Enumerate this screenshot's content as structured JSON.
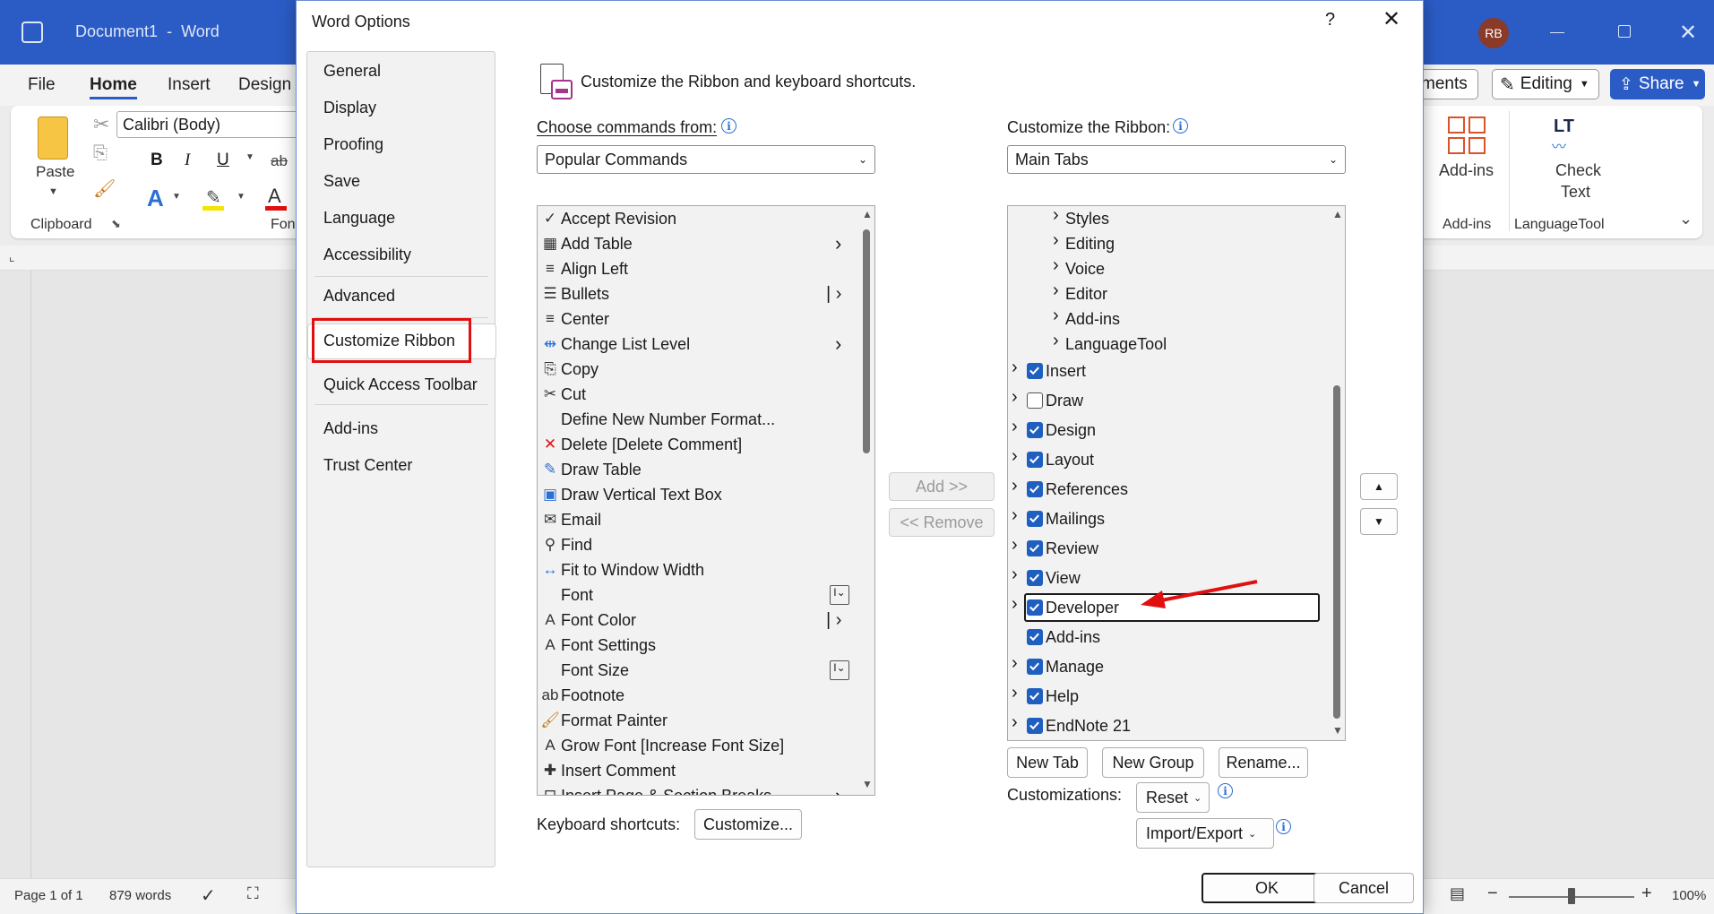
{
  "word": {
    "doc_title": "Document1",
    "separator": "-",
    "app_name": "Word",
    "user_initials": "RB",
    "menu": [
      "File",
      "Home",
      "Insert",
      "Design"
    ],
    "right_buttons": {
      "comments": "ments",
      "editing": "Editing",
      "share": "Share"
    },
    "ribbon": {
      "paste": "Paste",
      "clipboard": "Clipboard",
      "font_name": "Calibri (Body)",
      "font_group": "Font",
      "bold": "B",
      "italic": "I",
      "underline": "U",
      "strike": "ab",
      "addins": "Add-ins",
      "addins_group": "Add-ins",
      "check_text_1": "Check",
      "check_text_2": "Text",
      "languagetool_group": "LanguageTool",
      "lt_logo": "LT"
    },
    "status": {
      "page": "Page 1 of 1",
      "words": "879 words",
      "zoom": "100%"
    }
  },
  "dialog": {
    "title": "Word Options",
    "help": "?",
    "nav": [
      "General",
      "Display",
      "Proofing",
      "Save",
      "Language",
      "Accessibility",
      "Advanced",
      "Customize Ribbon",
      "Quick Access Toolbar",
      "Add-ins",
      "Trust Center"
    ],
    "selected_nav": "Customize Ribbon",
    "heading": "Customize the Ribbon and keyboard shortcuts.",
    "choose_label": "Choose commands from:",
    "choose_value": "Popular Commands",
    "customize_label": "Customize the Ribbon:",
    "customize_value": "Main Tabs",
    "commands": [
      {
        "label": "Accept Revision",
        "icon": "accept-revision-icon"
      },
      {
        "label": "Add Table",
        "icon": "table-icon",
        "suffix": "arrow"
      },
      {
        "label": "Align Left",
        "icon": "align-left-icon"
      },
      {
        "label": "Bullets",
        "icon": "bullets-icon",
        "suffix": "split-arrow"
      },
      {
        "label": "Center",
        "icon": "align-center-icon"
      },
      {
        "label": "Change List Level",
        "icon": "list-level-icon",
        "suffix": "arrow"
      },
      {
        "label": "Copy",
        "icon": "copy-icon"
      },
      {
        "label": "Cut",
        "icon": "scissors-icon"
      },
      {
        "label": "Define New Number Format...",
        "icon": ""
      },
      {
        "label": "Delete [Delete Comment]",
        "icon": "delete-comment-icon"
      },
      {
        "label": "Draw Table",
        "icon": "draw-table-icon"
      },
      {
        "label": "Draw Vertical Text Box",
        "icon": "text-box-icon"
      },
      {
        "label": "Email",
        "icon": "email-icon"
      },
      {
        "label": "Find",
        "icon": "find-icon"
      },
      {
        "label": "Fit to Window Width",
        "icon": "fit-width-icon"
      },
      {
        "label": "Font",
        "icon": "",
        "suffix": "combo"
      },
      {
        "label": "Font Color",
        "icon": "font-color-icon",
        "suffix": "split-arrow"
      },
      {
        "label": "Font Settings",
        "icon": "font-settings-icon"
      },
      {
        "label": "Font Size",
        "icon": "",
        "suffix": "combo"
      },
      {
        "label": "Footnote",
        "icon": "footnote-icon"
      },
      {
        "label": "Format Painter",
        "icon": "format-painter-icon"
      },
      {
        "label": "Grow Font [Increase Font Size]",
        "icon": "grow-font-icon"
      },
      {
        "label": "Insert Comment",
        "icon": "insert-comment-icon"
      },
      {
        "label": "Insert Page & Section Breaks",
        "icon": "page-break-icon",
        "suffix": "arrow"
      }
    ],
    "tabs": [
      {
        "label": "Styles",
        "level": 1
      },
      {
        "label": "Editing",
        "level": 1
      },
      {
        "label": "Voice",
        "level": 1
      },
      {
        "label": "Editor",
        "level": 1
      },
      {
        "label": "Add-ins",
        "level": 1
      },
      {
        "label": "LanguageTool",
        "level": 1
      },
      {
        "label": "Insert",
        "level": 0,
        "checked": true
      },
      {
        "label": "Draw",
        "level": 0,
        "checked": false
      },
      {
        "label": "Design",
        "level": 0,
        "checked": true
      },
      {
        "label": "Layout",
        "level": 0,
        "checked": true
      },
      {
        "label": "References",
        "level": 0,
        "checked": true
      },
      {
        "label": "Mailings",
        "level": 0,
        "checked": true
      },
      {
        "label": "Review",
        "level": 0,
        "checked": true
      },
      {
        "label": "View",
        "level": 0,
        "checked": true
      },
      {
        "label": "Developer",
        "level": 0,
        "checked": true,
        "selected": true
      },
      {
        "label": "Add-ins",
        "level": 0,
        "checked": true,
        "noexpand": true
      },
      {
        "label": "Manage",
        "level": 0,
        "checked": true
      },
      {
        "label": "Help",
        "level": 0,
        "checked": true
      },
      {
        "label": "EndNote 21",
        "level": 0,
        "checked": true
      }
    ],
    "add_button": "Add >>",
    "remove_button": "<< Remove",
    "new_tab": "New Tab",
    "new_group": "New Group",
    "rename": "Rename...",
    "customizations_label": "Customizations:",
    "reset": "Reset",
    "import_export": "Import/Export",
    "keyboard_label": "Keyboard shortcuts:",
    "customize_btn": "Customize...",
    "ok": "OK",
    "cancel": "Cancel",
    "info_glyph": "i"
  },
  "colors": {
    "word_blue": "#2b5cc6",
    "highlight_red": "#e01010",
    "checkbox_blue": "#1f5fbf"
  }
}
